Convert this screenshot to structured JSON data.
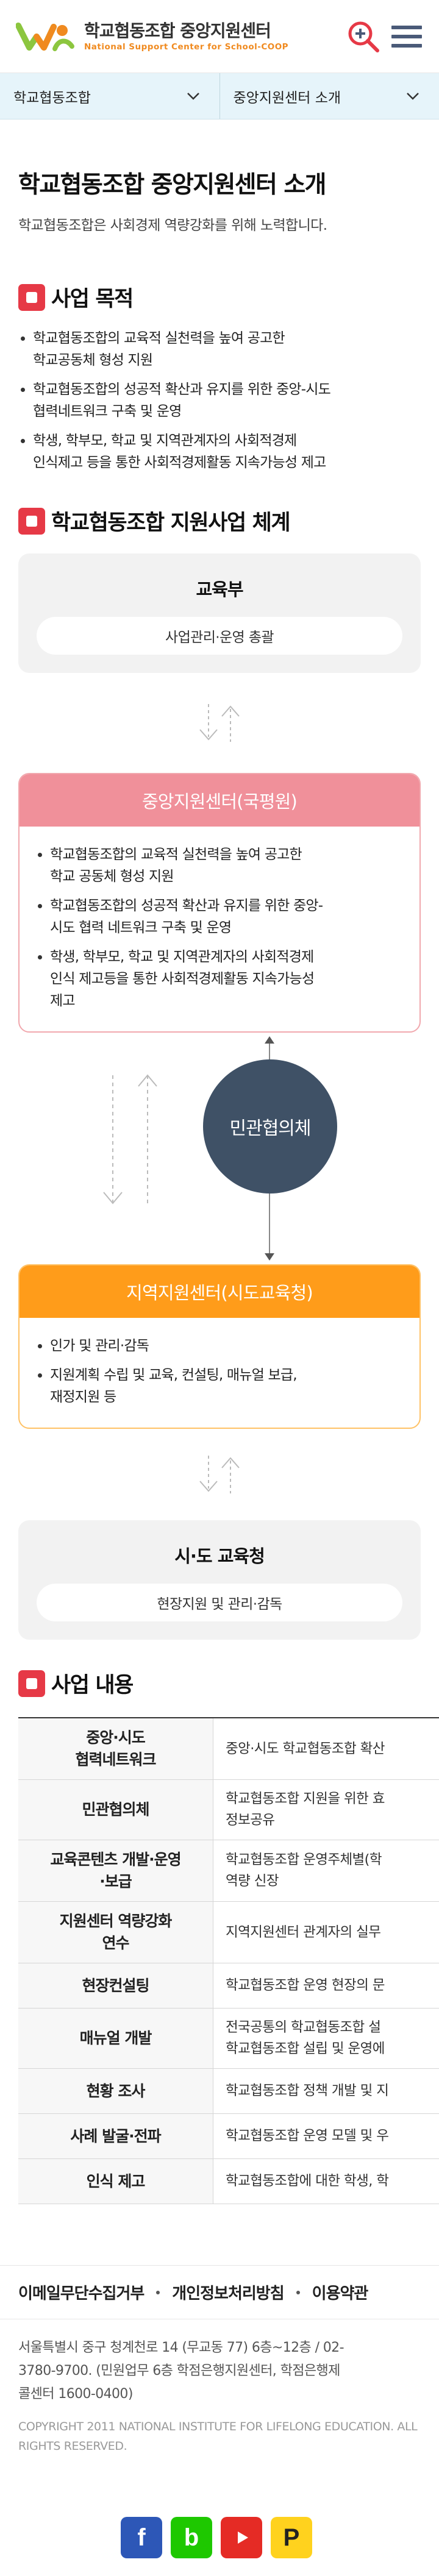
{
  "header": {
    "logo_title": "학교협동조합 중앙지원센터",
    "logo_subtitle": "National Support Center for School-COOP",
    "icons": [
      "zoom-in-icon",
      "menu-icon"
    ],
    "colors": {
      "logo_green": "#8cc63f",
      "logo_orange": "#f08a1f",
      "icon_red": "#e63946",
      "icon_navy": "#4a5a78"
    }
  },
  "breadcrumb": {
    "level1": "학교협동조합",
    "level2": "중앙지원센터 소개"
  },
  "main": {
    "title": "학교협동조합 중앙지원센터 소개",
    "subtitle": "학교협동조합은 사회경제 역량강화를 위해 노력합니다.",
    "purpose": {
      "heading": "사업 목적",
      "items": [
        [
          "학교협동조합의 교육적 실천력을 높여 공고한",
          "학교공동체 형성 지원"
        ],
        [
          "학교협동조합의 성공적 확산과 유지를 위한 중앙-시도",
          "협력네트워크 구축 및 운영"
        ],
        [
          "학생, 학부모, 학교 및 지역관계자의 사회적경제",
          "인식제고 등을 통한 사회적경제활동 지속가능성 제고"
        ]
      ]
    },
    "structure": {
      "heading": "학교협동조합 지원사업 체계",
      "ministry": {
        "title": "교육부",
        "role": "사업관리·운영 총괄"
      },
      "central": {
        "title": "중앙지원센터(국평원)",
        "items": [
          [
            "학교협동조합의 교육적 실천력을 높여 공고한",
            "학교 공동체 형성 지원"
          ],
          [
            "학교협동조합의 성공적 확산과 유지를 위한 중앙-",
            "시도 협력 네트워크 구축 및 운영"
          ],
          [
            "학생, 학부모, 학교 및 지역관계자의 사회적경제",
            "인식 제고등을 통한 사회적경제활동 지속가능성",
            "제고"
          ]
        ]
      },
      "council": "민관협의체",
      "regional": {
        "title": "지역지원센터(시도교육청)",
        "items": [
          [
            "인가 및 관리·감독"
          ],
          [
            "지원계획 수립 및 교육, 컨설팅, 매뉴얼 보급,",
            "재정지원 등"
          ]
        ]
      },
      "provincial": {
        "title": "시·도 교육청",
        "role": "현장지원 및 관리·감독"
      },
      "colors": {
        "central": "#f0909a",
        "regional": "#ff9c1a",
        "council": "#3f5166"
      }
    },
    "business": {
      "heading": "사업 내용",
      "rows": [
        {
          "key": [
            "중앙·시도",
            "협력네트워크"
          ],
          "value": [
            "중앙·시도 학교협동조합 확산"
          ]
        },
        {
          "key": [
            "민관협의체"
          ],
          "value": [
            "학교협동조합 지원을 위한 효",
            "정보공유"
          ]
        },
        {
          "key": [
            "교육콘텐츠 개발·운영",
            "·보급"
          ],
          "value": [
            "학교협동조합 운영주체별(학",
            "역량 신장"
          ]
        },
        {
          "key": [
            "지원센터 역량강화",
            "연수"
          ],
          "value": [
            "지역지원센터 관계자의 실무"
          ]
        },
        {
          "key": [
            "현장컨설팅"
          ],
          "value": [
            "학교협동조합 운영 현장의 문"
          ]
        },
        {
          "key": [
            "매뉴얼 개발"
          ],
          "value": [
            "전국공통의 학교협동조합 설",
            "학교협동조합 설립 및 운영에"
          ]
        },
        {
          "key": [
            "현황 조사"
          ],
          "value": [
            "학교협동조합 정책 개발 및 지"
          ]
        },
        {
          "key": [
            "사례 발굴·전파"
          ],
          "value": [
            "학교협동조합 운영 모델 및 우"
          ]
        },
        {
          "key": [
            "인식 제고"
          ],
          "value": [
            "학교협동조합에 대한 학생, 학"
          ]
        }
      ]
    }
  },
  "footer": {
    "links": [
      "이메일무단수집거부",
      "개인정보처리방침",
      "이용약관"
    ],
    "address": [
      "서울특별시 중구 청계천로 14 (무교동 77) 6층~12층 / 02-",
      "3780-9700. (민원업무 6층 학점은행지원센터, 학점은행제",
      "콜센터 1600-0400)"
    ],
    "copyright": [
      "COPYRIGHT 2011 NATIONAL INSTITUTE FOR LIFELONG EDUCATION. ALL",
      "RIGHTS RESERVED."
    ],
    "sns": [
      {
        "icon": "facebook-icon",
        "glyph": "f"
      },
      {
        "icon": "blog-icon",
        "glyph": "b"
      },
      {
        "icon": "youtube-icon",
        "glyph": ""
      },
      {
        "icon": "post-icon",
        "glyph": "P"
      }
    ]
  }
}
